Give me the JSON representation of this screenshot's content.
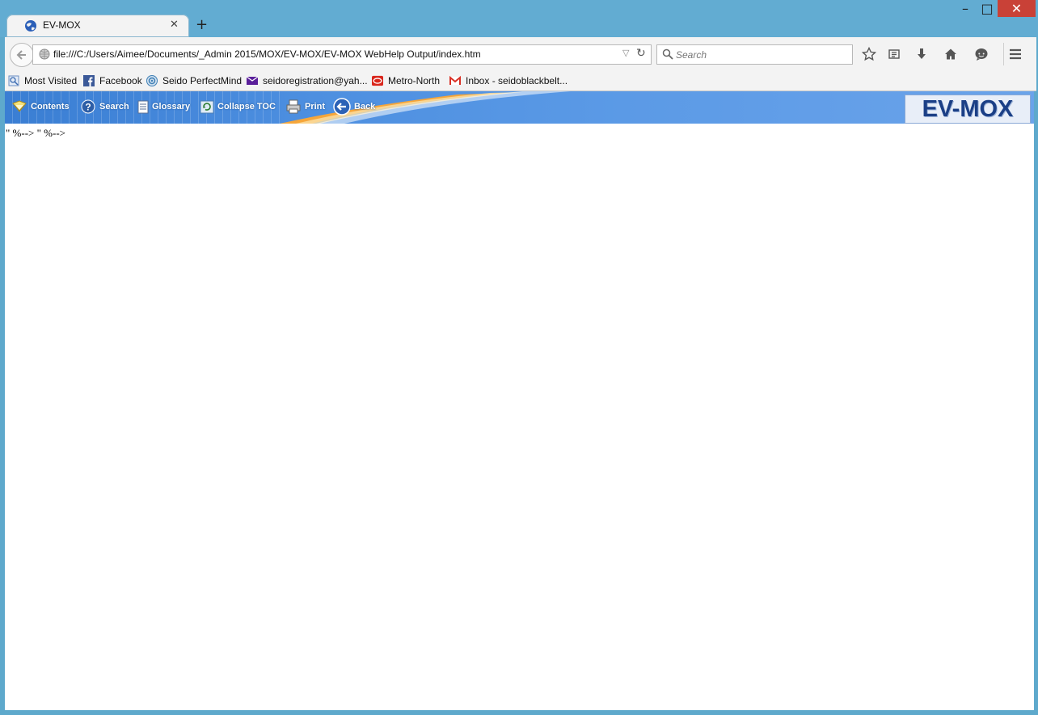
{
  "window": {
    "minimize_glyph": "–",
    "maximize_glyph": "□",
    "close_glyph": "✕"
  },
  "tab": {
    "title": "EV-MOX",
    "close_glyph": "✕",
    "new_tab_glyph": "+"
  },
  "navbar": {
    "url": "file:///C:/Users/Aimee/Documents/_Admin 2015/MOX/EV-MOX/EV-MOX WebHelp Output/index.htm",
    "search_placeholder": "Search",
    "icons": [
      "back-arrow-icon",
      "globe-icon",
      "dropdown-icon",
      "reload-icon",
      "search-icon",
      "star-icon",
      "reading-list-icon",
      "download-icon",
      "home-icon",
      "chat-icon",
      "menu-icon"
    ]
  },
  "bookmarks": [
    {
      "label": "Most Visited",
      "icon": "most-visited-icon"
    },
    {
      "label": "Facebook",
      "icon": "facebook-icon"
    },
    {
      "label": "Seido PerfectMind",
      "icon": "perfectmind-icon"
    },
    {
      "label": "seidoregistration@yah...",
      "icon": "mail-icon"
    },
    {
      "label": "Metro-North",
      "icon": "metro-north-icon"
    },
    {
      "label": "Inbox - seidoblackbelt...",
      "icon": "gmail-icon"
    }
  ],
  "help_toolbar": {
    "buttons": [
      {
        "label": "Contents",
        "icon": "contents-icon"
      },
      {
        "label": "Search",
        "icon": "search-help-icon"
      },
      {
        "label": "Glossary",
        "icon": "glossary-icon"
      },
      {
        "label": "Collapse TOC",
        "icon": "collapse-toc-icon"
      },
      {
        "label": "Print",
        "icon": "print-icon"
      },
      {
        "label": "Back",
        "icon": "back-icon"
      }
    ],
    "logo_text": "EV-MOX"
  },
  "content": {
    "text": "\" %--> \" %-->"
  },
  "colors": {
    "window_frame": "#62acd2",
    "close_button": "#c94137",
    "help_toolbar_blue": "#4d8fe0",
    "logo_text": "#1b3f86"
  }
}
